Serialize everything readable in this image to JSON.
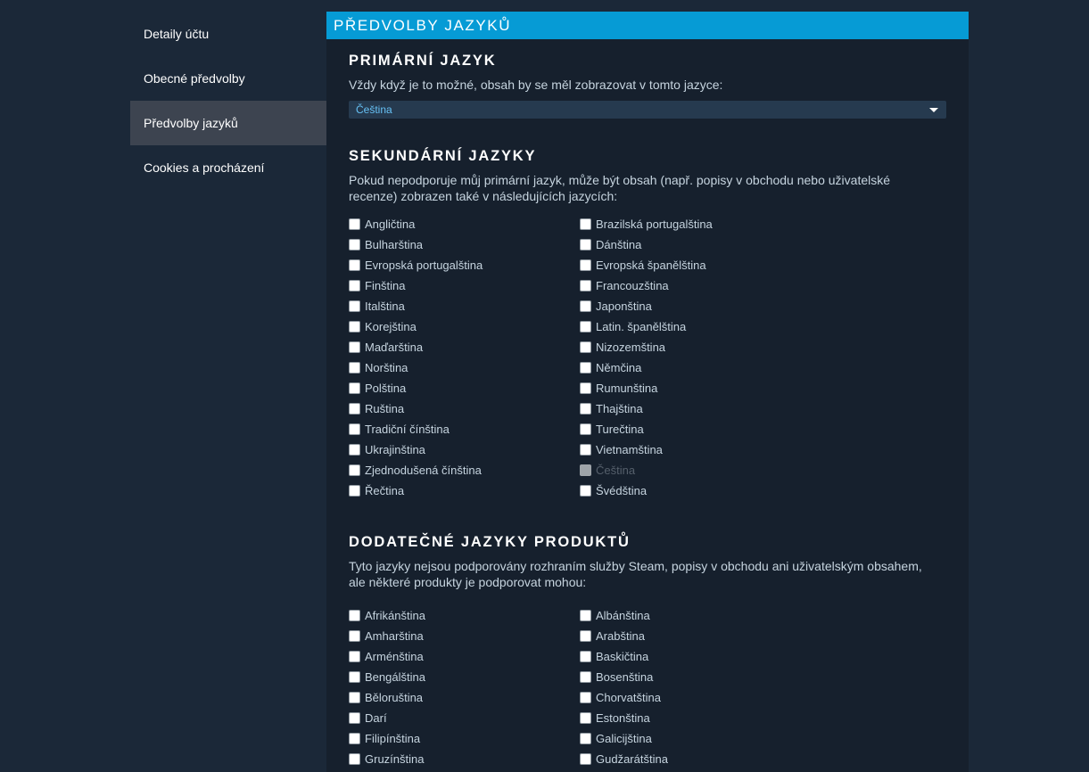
{
  "sidebar": {
    "items": [
      {
        "label": "Detaily účtu"
      },
      {
        "label": "Obecné předvolby"
      },
      {
        "label": "Předvolby jazyků"
      },
      {
        "label": "Cookies a procházení"
      }
    ]
  },
  "panel": {
    "title": "Předvolby jazyků"
  },
  "primary": {
    "title": "Primární jazyk",
    "desc": "Vždy když je to možné, obsah by se měl zobrazovat v tomto jazyce:",
    "selected": "Čeština"
  },
  "secondary": {
    "title": "Sekundární jazyky",
    "desc_line1": "Pokud nepodporuje můj primární jazyk, může být obsah (např. popisy v obchodu nebo uživatelské",
    "desc_line2": "recenze) zobrazen také v následujících jazycích:",
    "left": [
      "Angličtina",
      "Bulharština",
      "Evropská portugalština",
      "Finština",
      "Italština",
      "Korejština",
      "Maďarština",
      "Norština",
      "Polština",
      "Ruština",
      "Tradiční čínština",
      "Ukrajinština",
      "Zjednodušená čínština",
      "Řečtina"
    ],
    "right": [
      "Brazilská portugalština",
      "Dánština",
      "Evropská španělština",
      "Francouzština",
      "Japonština",
      "Latin. španělština",
      "Nizozemština",
      "Němčina",
      "Rumunština",
      "Thajština",
      "Turečtina",
      "Vietnamština",
      "Čeština",
      "Švédština"
    ],
    "disabled_right_index": 12
  },
  "additional": {
    "title": "Dodatečné jazyky produktů",
    "desc_line1": "Tyto jazyky nejsou podporovány rozhraním služby Steam, popisy v obchodu ani uživatelským obsahem,",
    "desc_line2": "ale některé produkty je podporovat mohou:",
    "left": [
      "Afrikánština",
      "Amharština",
      "Arménština",
      "Bengálština",
      "Běloruština",
      "Darí",
      "Filipínština",
      "Gruzínština"
    ],
    "right": [
      "Albánština",
      "Arabština",
      "Baskičtina",
      "Bosenština",
      "Chorvatština",
      "Estonština",
      "Galicijština",
      "Gudžarátština"
    ]
  },
  "colors": {
    "background": "#1b2838",
    "panel": "#16202d",
    "header": "#069bd5",
    "sidebar_active": "#3d4450",
    "link": "#66c0f4"
  },
  "icons": {
    "dropdown": "chevron-down-icon"
  }
}
